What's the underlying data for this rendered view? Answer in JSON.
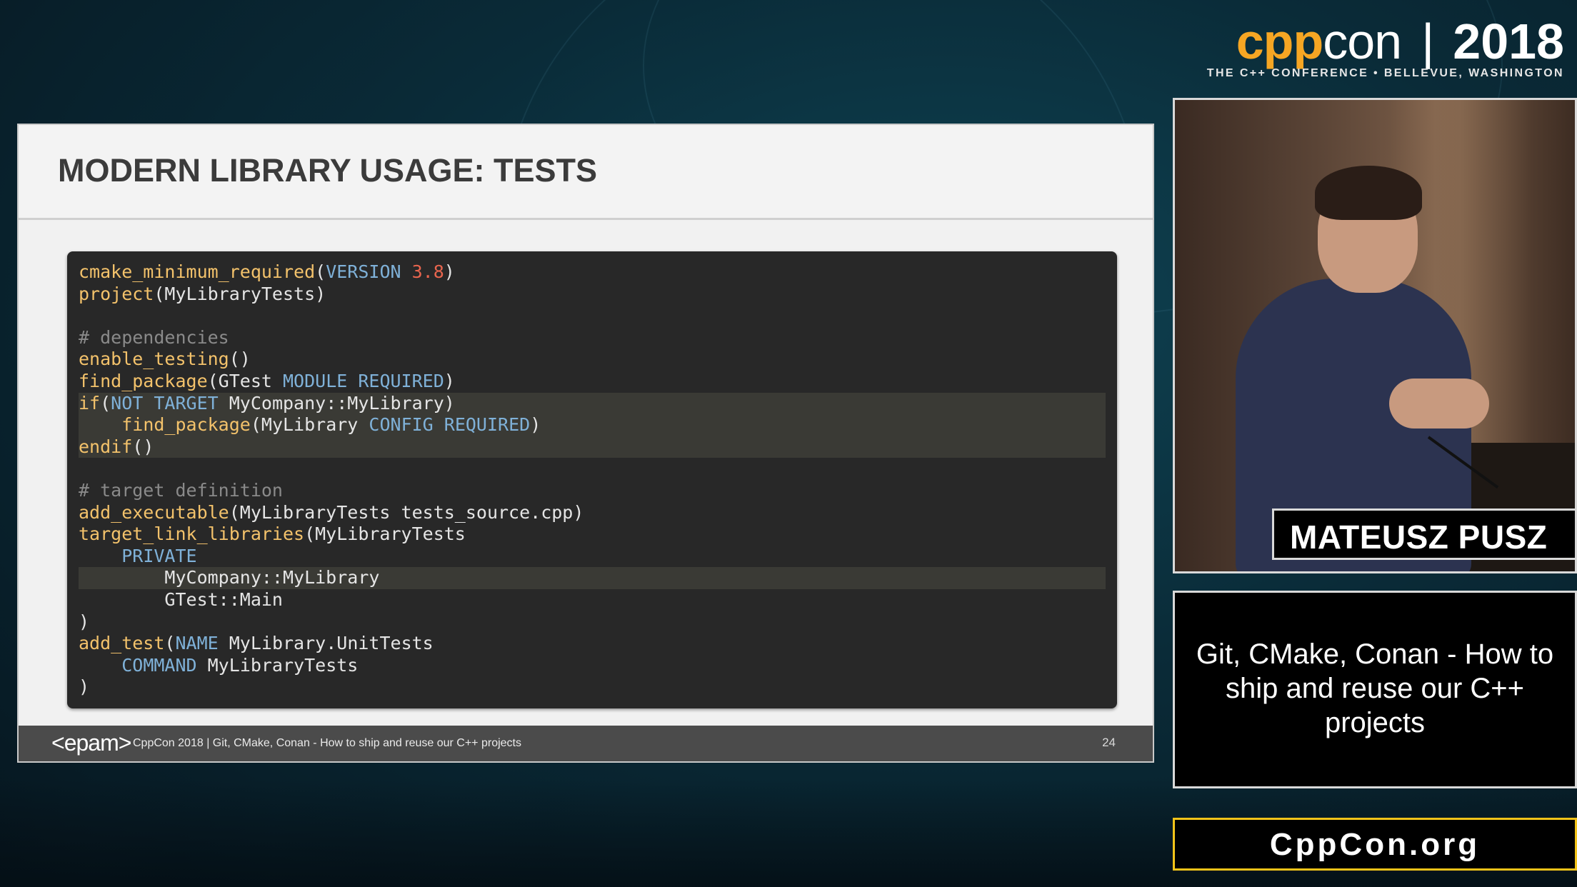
{
  "conference": {
    "logo_cpp": "cpp",
    "logo_con": "con",
    "logo_separator": "|",
    "logo_year": "2018",
    "tagline": "THE C++ CONFERENCE • BELLEVUE, WASHINGTON",
    "accent_color": "#f6a623"
  },
  "slide": {
    "title": "MODERN LIBRARY USAGE: TESTS",
    "code_lines": [
      [
        {
          "t": "cmake_minimum_required",
          "c": "fn"
        },
        {
          "t": "(",
          "c": "id"
        },
        {
          "t": "VERSION",
          "c": "kw"
        },
        {
          "t": " ",
          "c": "id"
        },
        {
          "t": "3.8",
          "c": "num"
        },
        {
          "t": ")",
          "c": "id"
        }
      ],
      [
        {
          "t": "project",
          "c": "fn"
        },
        {
          "t": "(MyLibraryTests)",
          "c": "id"
        }
      ],
      [],
      [
        {
          "t": "# dependencies",
          "c": "cm"
        }
      ],
      [
        {
          "t": "enable_testing",
          "c": "fn"
        },
        {
          "t": "()",
          "c": "id"
        }
      ],
      [
        {
          "t": "find_package",
          "c": "fn"
        },
        {
          "t": "(GTest ",
          "c": "id"
        },
        {
          "t": "MODULE REQUIRED",
          "c": "kw"
        },
        {
          "t": ")",
          "c": "id"
        }
      ],
      [
        {
          "t": "if",
          "c": "fn"
        },
        {
          "t": "(",
          "c": "id"
        },
        {
          "t": "NOT TARGET",
          "c": "kw"
        },
        {
          "t": " MyCompany::MyLibrary)",
          "c": "id"
        }
      ],
      [
        {
          "t": "    ",
          "c": "id"
        },
        {
          "t": "find_package",
          "c": "fn"
        },
        {
          "t": "(MyLibrary ",
          "c": "id"
        },
        {
          "t": "CONFIG REQUIRED",
          "c": "kw"
        },
        {
          "t": ")",
          "c": "id"
        }
      ],
      [
        {
          "t": "endif",
          "c": "fn"
        },
        {
          "t": "()",
          "c": "id"
        }
      ],
      [],
      [
        {
          "t": "# target definition",
          "c": "cm"
        }
      ],
      [
        {
          "t": "add_executable",
          "c": "fn"
        },
        {
          "t": "(MyLibraryTests tests_source.cpp)",
          "c": "id"
        }
      ],
      [
        {
          "t": "target_link_libraries",
          "c": "fn"
        },
        {
          "t": "(MyLibraryTests",
          "c": "id"
        }
      ],
      [
        {
          "t": "    ",
          "c": "id"
        },
        {
          "t": "PRIVATE",
          "c": "kw"
        }
      ],
      [
        {
          "t": "        MyCompany::MyLibrary",
          "c": "id"
        }
      ],
      [
        {
          "t": "        GTest::Main",
          "c": "id"
        }
      ],
      [
        {
          "t": ")",
          "c": "id"
        }
      ],
      [
        {
          "t": "add_test",
          "c": "fn"
        },
        {
          "t": "(",
          "c": "id"
        },
        {
          "t": "NAME",
          "c": "kw"
        },
        {
          "t": " MyLibrary.UnitTests",
          "c": "id"
        }
      ],
      [
        {
          "t": "    ",
          "c": "id"
        },
        {
          "t": "COMMAND",
          "c": "kw"
        },
        {
          "t": " MyLibraryTests",
          "c": "id"
        }
      ],
      [
        {
          "t": ")",
          "c": "id"
        }
      ]
    ],
    "highlighted_lines": [
      6,
      7,
      8,
      14
    ],
    "colors": {
      "function": "#f3c26b",
      "keyword": "#7fb1d8",
      "number": "#e8654e",
      "comment": "#8a8a8a",
      "code_background": "#282828",
      "highlight_background": "#3a3a35"
    },
    "footer": {
      "logo": "<epam>",
      "text": "CppCon 2018 | Git, CMake, Conan - How to ship and reuse our C++ projects",
      "page_number": "24"
    }
  },
  "speaker": {
    "name": "MATEUSZ PUSZ"
  },
  "talk": {
    "title": "Git, CMake, Conan - How to ship and reuse our C++ projects"
  },
  "website": {
    "label": "CppCon.org",
    "border_color": "#f2c319"
  }
}
